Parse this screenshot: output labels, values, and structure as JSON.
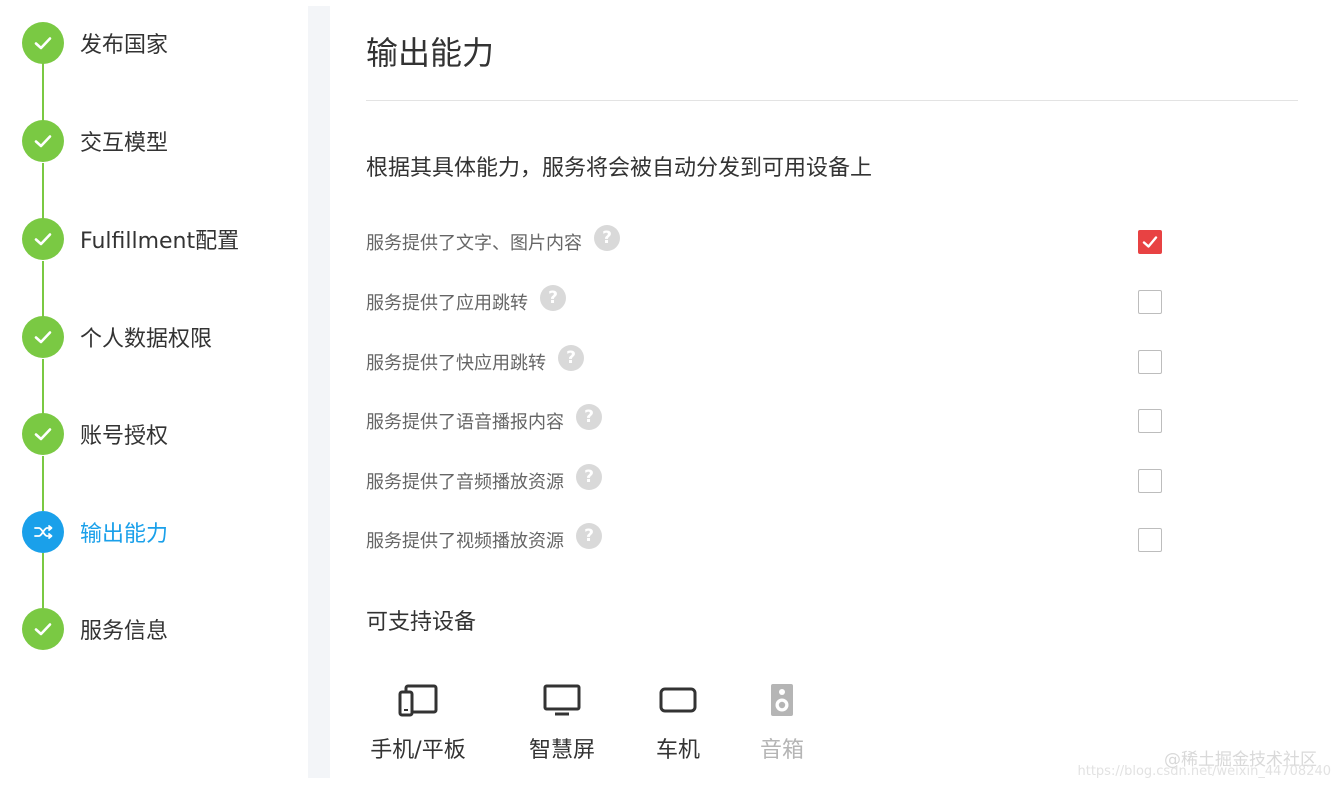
{
  "stepper": {
    "steps": [
      {
        "label": "发布国家",
        "status": "done"
      },
      {
        "label": "交互模型",
        "status": "done"
      },
      {
        "label": "Fulfillment配置",
        "status": "done"
      },
      {
        "label": "个人数据权限",
        "status": "done"
      },
      {
        "label": "账号授权",
        "status": "done"
      },
      {
        "label": "输出能力",
        "status": "active"
      },
      {
        "label": "服务信息",
        "status": "done"
      }
    ]
  },
  "main": {
    "title": "输出能力",
    "description": "根据其具体能力，服务将会被自动分发到可用设备上",
    "capabilities": [
      {
        "label": "服务提供了文字、图片内容",
        "help": "?",
        "checked": true
      },
      {
        "label": "服务提供了应用跳转",
        "help": "?",
        "checked": false
      },
      {
        "label": "服务提供了快应用跳转",
        "help": "?",
        "checked": false
      },
      {
        "label": "服务提供了语音播报内容",
        "help": "?",
        "checked": false
      },
      {
        "label": "服务提供了音频播放资源",
        "help": "?",
        "checked": false
      },
      {
        "label": "服务提供了视频播放资源",
        "help": "?",
        "checked": false
      }
    ],
    "devices_heading": "可支持设备",
    "devices": [
      {
        "label": "手机/平板",
        "icon": "phone-tablet-icon",
        "enabled": true
      },
      {
        "label": "智慧屏",
        "icon": "smart-screen-icon",
        "enabled": true
      },
      {
        "label": "车机",
        "icon": "car-unit-icon",
        "enabled": true
      },
      {
        "label": "音箱",
        "icon": "speaker-icon",
        "enabled": false
      }
    ]
  },
  "watermark": {
    "brand": "@稀土掘金技术社区",
    "url": "https://blog.csdn.net/weixin_44708240"
  },
  "colors": {
    "step_done": "#7ac943",
    "step_active": "#1aa0ea",
    "checkbox_checked": "#e84243",
    "divider": "#e3e3e3"
  }
}
